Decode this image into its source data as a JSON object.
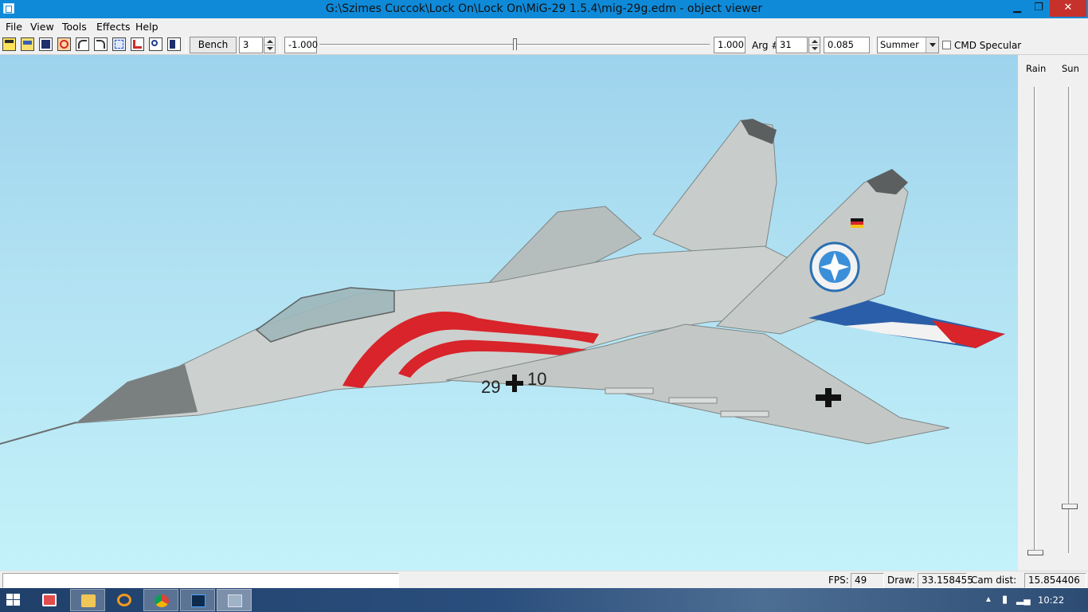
{
  "window": {
    "title": "G:\\Szimes Cuccok\\Lock On\\Lock On\\MiG-29 1.5.4\\mig-29g.edm - object viewer",
    "minimize": "▁",
    "maximize": "❐",
    "close": "✕"
  },
  "menu": {
    "items": [
      "File",
      "View",
      "Tools",
      "Effects",
      "Help"
    ]
  },
  "toolbar": {
    "icons": [
      "open-icon",
      "save-icon",
      "edit-icon",
      "animation-icon",
      "undo-icon",
      "redo-icon",
      "wireframe-icon",
      "run-icon",
      "zoom-icon",
      "properties-icon"
    ],
    "bench_label": "Bench",
    "bench_value": "3",
    "min_value": "-1.000",
    "max_value": "1.000",
    "slider_position": 0.5,
    "arg_label": "Arg #",
    "arg_value": "31",
    "arg_param": "0.085",
    "season_selected": "Summer",
    "cmd_specular_label": "CMD Specular",
    "cmd_specular_checked": false
  },
  "viewport": {
    "model_markings": {
      "fuselage_number_left": "29",
      "fuselage_number_right": "10"
    }
  },
  "side_panel": {
    "rain_label": "Rain",
    "sun_label": "Sun",
    "rain_level": 0.0,
    "sun_level": 0.1
  },
  "status": {
    "message": "",
    "fps_label": "FPS:",
    "fps_value": "49",
    "draw_label": "Draw:",
    "draw_value": "33.158455",
    "camdist_label": "Cam dist:",
    "camdist_value": "15.854406"
  },
  "taskbar": {
    "apps": [
      "explorer",
      "file-manager",
      "media",
      "chrome",
      "photoshop",
      "object-viewer"
    ],
    "clock": "10:22",
    "colors": {
      "accent": "#0f8ad8",
      "close": "#c7312b",
      "sky_top": "#9ed3ed",
      "sky_bottom": "#c4f2fa"
    }
  }
}
